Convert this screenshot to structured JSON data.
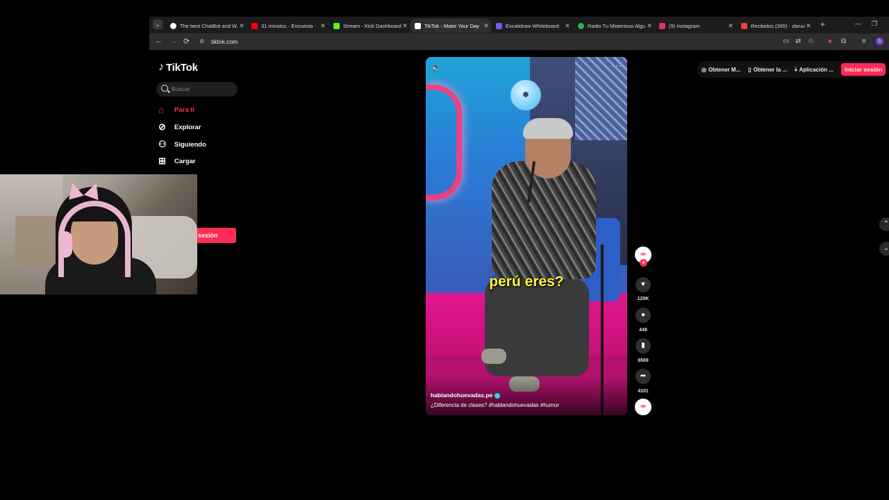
{
  "browser": {
    "tabs": [
      {
        "label": "The best ChatBot and W...",
        "fav": "#ffffff",
        "active": false
      },
      {
        "label": "31 minutos - Encuesta - ...",
        "fav": "#ff0000",
        "active": false
      },
      {
        "label": "Stream - Kick Dashboard",
        "fav": "#53fc18",
        "active": false
      },
      {
        "label": "TikTok - Make Your Day",
        "fav": "#111111",
        "active": true
      },
      {
        "label": "Excalidraw Whiteboard",
        "fav": "#6965db",
        "active": false
      },
      {
        "label": "Radio Tu Misterioso Algu...",
        "fav": "#1db954",
        "active": false
      },
      {
        "label": "(9) Instagram",
        "fav": "#e1306c",
        "active": false
      },
      {
        "label": "Recibidos (395) - zbruun...",
        "fav": "#ea4335",
        "active": false
      }
    ],
    "url": "tiktok.com"
  },
  "sidebar": {
    "logo": "TikTok",
    "search_placeholder": "Buscar",
    "nav": [
      {
        "label": "Para ti",
        "icon": "home-icon",
        "active": true
      },
      {
        "label": "Explorar",
        "icon": "compass-icon",
        "active": false
      },
      {
        "label": "Siguiendo",
        "icon": "following-icon",
        "active": false
      },
      {
        "label": "Cargar",
        "icon": "upload-icon",
        "active": false
      }
    ],
    "login_label": "sesión"
  },
  "video": {
    "caption": "perú eres?",
    "author": "hablandohuevadas.pe",
    "description": "¿Diferencia de clases? #hablandohuevadas #humor"
  },
  "actions": {
    "likes": "120K",
    "comments": "449",
    "saves": "6569",
    "shares": "4101"
  },
  "topbar": {
    "items": [
      "Obtener M...",
      "Obtener la ...",
      "Aplicación ..."
    ],
    "login": "Iniciar sesión"
  },
  "colors": {
    "accent": "#fe2c55",
    "caption": "#fff93a"
  }
}
